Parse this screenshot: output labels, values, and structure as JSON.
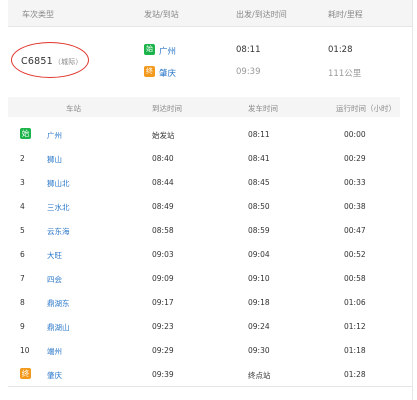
{
  "summary": {
    "headers": [
      "车次类型",
      "发站/到站",
      "出发/到达时间",
      "耗时/里程"
    ],
    "train": {
      "code": "C6851",
      "type": "（城际）"
    },
    "from": {
      "badge": "始",
      "station": "广州",
      "time": "08:11"
    },
    "to": {
      "badge": "终",
      "station": "肇庆",
      "time": "09:39"
    },
    "duration": "01:28",
    "distance": "111公里"
  },
  "table": {
    "headers": [
      "车站",
      "到达时间",
      "发车时间",
      "运行时间（小时）"
    ],
    "rows": [
      {
        "no": "始",
        "station": "广州",
        "arrive": "始发站",
        "depart": "08:11",
        "elapsed": "00:00"
      },
      {
        "no": "2",
        "station": "狮山",
        "arrive": "08:40",
        "depart": "08:41",
        "elapsed": "00:29"
      },
      {
        "no": "3",
        "station": "狮山北",
        "arrive": "08:44",
        "depart": "08:45",
        "elapsed": "00:33"
      },
      {
        "no": "4",
        "station": "三水北",
        "arrive": "08:49",
        "depart": "08:50",
        "elapsed": "00:38"
      },
      {
        "no": "5",
        "station": "云东海",
        "arrive": "08:58",
        "depart": "08:59",
        "elapsed": "00:47"
      },
      {
        "no": "6",
        "station": "大旺",
        "arrive": "09:03",
        "depart": "09:04",
        "elapsed": "00:52"
      },
      {
        "no": "7",
        "station": "四会",
        "arrive": "09:09",
        "depart": "09:10",
        "elapsed": "00:58"
      },
      {
        "no": "8",
        "station": "鼎湖东",
        "arrive": "09:17",
        "depart": "09:18",
        "elapsed": "01:06"
      },
      {
        "no": "9",
        "station": "鼎湖山",
        "arrive": "09:23",
        "depart": "09:24",
        "elapsed": "01:12"
      },
      {
        "no": "10",
        "station": "端州",
        "arrive": "09:29",
        "depart": "09:30",
        "elapsed": "01:18"
      },
      {
        "no": "终",
        "station": "肇庆",
        "arrive": "09:39",
        "depart": "终点站",
        "elapsed": "01:28"
      }
    ]
  },
  "colors": {
    "start_badge": "#1bb34a",
    "end_badge": "#f39a1e",
    "station_link": "#2a77c9",
    "highlight_circle": "#e0352b"
  }
}
